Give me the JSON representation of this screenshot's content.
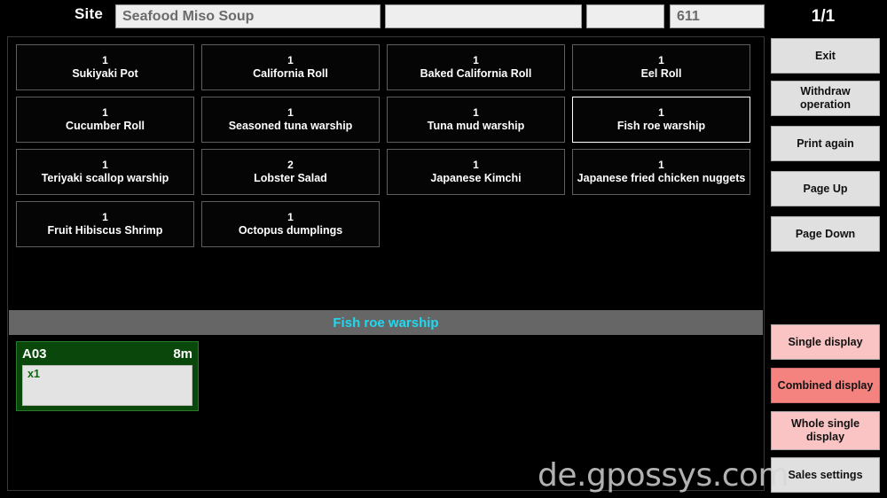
{
  "header": {
    "site_label": "Site",
    "site_value": "Seafood Miso Soup",
    "field_mid_value": "",
    "field_small_value": "",
    "code_value": "611",
    "page_indicator": "1/1"
  },
  "items": [
    {
      "qty": "1",
      "name": "Sukiyaki Pot",
      "selected": false
    },
    {
      "qty": "1",
      "name": "California Roll",
      "selected": false
    },
    {
      "qty": "1",
      "name": "Baked California Roll",
      "selected": false
    },
    {
      "qty": "1",
      "name": "Eel Roll",
      "selected": false
    },
    {
      "qty": "1",
      "name": "Cucumber Roll",
      "selected": false
    },
    {
      "qty": "1",
      "name": "Seasoned tuna warship",
      "selected": false
    },
    {
      "qty": "1",
      "name": "Tuna mud warship",
      "selected": false
    },
    {
      "qty": "1",
      "name": "Fish roe warship",
      "selected": true
    },
    {
      "qty": "1",
      "name": "Teriyaki scallop warship",
      "selected": false
    },
    {
      "qty": "2",
      "name": "Lobster Salad",
      "selected": false
    },
    {
      "qty": "1",
      "name": "Japanese Kimchi",
      "selected": false
    },
    {
      "qty": "1",
      "name": "Japanese fried chicken nuggets",
      "selected": false
    },
    {
      "qty": "1",
      "name": "Fruit Hibiscus Shrimp",
      "selected": false
    },
    {
      "qty": "1",
      "name": "Octopus dumplings",
      "selected": false
    }
  ],
  "status_bar": {
    "text": "Fish roe warship"
  },
  "tickets": [
    {
      "id": "A03",
      "time": "8m",
      "line": "x1"
    }
  ],
  "sidebar": {
    "exit": "Exit",
    "withdraw": "Withdraw operation",
    "print_again": "Print again",
    "page_up": "Page Up",
    "page_down": "Page Down",
    "single_display": "Single display",
    "combined_display": "Combined display",
    "whole_single_display": "Whole single display",
    "sales_settings": "Sales settings"
  },
  "watermark": {
    "text": "de.gpossys.com"
  },
  "colors": {
    "background": "#000000",
    "field_fill": "#eeeeee",
    "field_text": "#6b6b6b",
    "card_border": "#5e5e5e",
    "card_border_selected": "#ffffff",
    "status_bar_bg": "#666666",
    "status_text": "#22d8f0",
    "ticket_green": "#0a470a",
    "ticket_body": "#e3e3e3",
    "ticket_line_text": "#0a6a0a",
    "sidebar_gray": "#e0e0e0",
    "sidebar_pink": "#fac4c4",
    "sidebar_pink_active": "#f4827f"
  }
}
